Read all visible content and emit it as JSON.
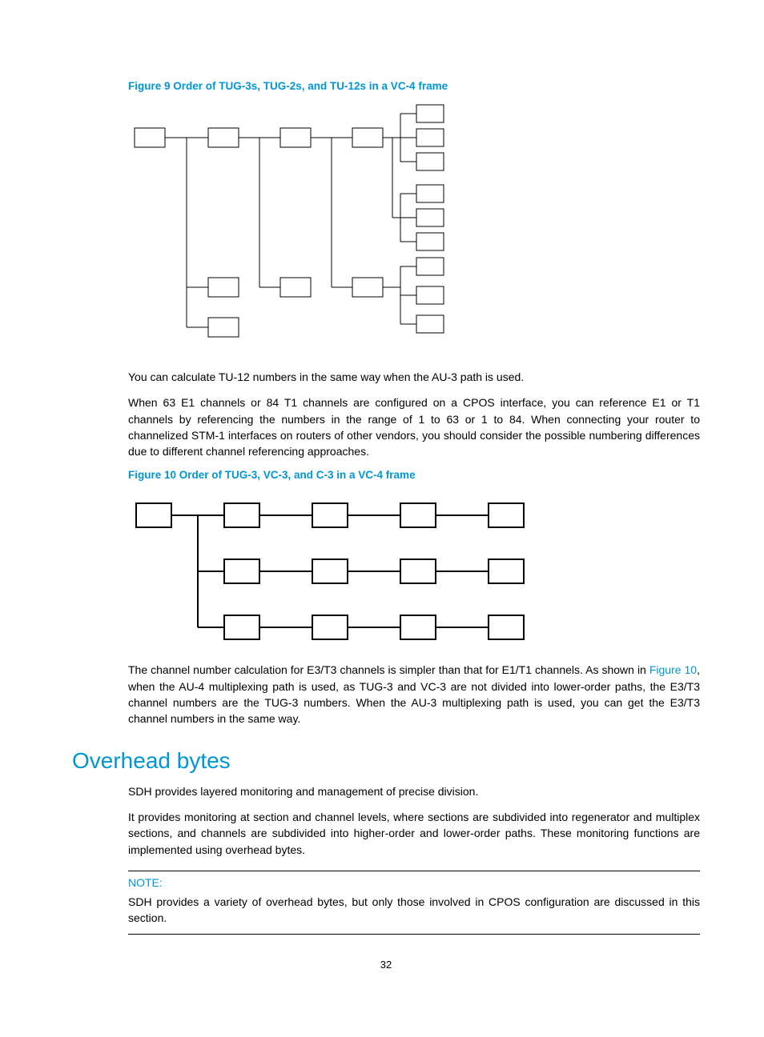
{
  "figure9": {
    "title": "Figure 9 Order of TUG-3s, TUG-2s, and TU-12s in a VC-4 frame"
  },
  "para1": "You can calculate TU-12 numbers in the same way when the AU-3 path is used.",
  "para2": "When 63 E1 channels or 84 T1 channels are configured on a CPOS interface, you can reference E1 or T1 channels by referencing the numbers in the range of 1 to 63 or 1 to 84. When connecting your router to channelized STM-1 interfaces on routers of other vendors, you should consider the possible numbering differences due to different channel referencing approaches.",
  "figure10": {
    "title": "Figure 10 Order of TUG-3, VC-3, and C-3 in a VC-4 frame",
    "ref": "Figure 10"
  },
  "para3_before": "The channel number calculation for E3/T3 channels is simpler than that for E1/T1 channels. As shown in ",
  "para3_after": ", when the AU-4 multiplexing path is used, as TUG-3 and VC-3 are not divided into lower-order paths, the E3/T3 channel numbers are the TUG-3 numbers. When the AU-3 multiplexing path is used, you can get the E3/T3 channel numbers in the same way.",
  "section_heading": "Overhead bytes",
  "para4": "SDH provides layered monitoring and management of precise division.",
  "para5": "It provides monitoring at section and channel levels, where sections are subdivided into regenerator and multiplex sections, and channels are subdivided into higher-order and lower-order paths. These monitoring functions are implemented using overhead bytes.",
  "note": {
    "label": "NOTE:",
    "content": "SDH provides a variety of overhead bytes, but only those involved in CPOS configuration are discussed in this section."
  },
  "page_number": "32"
}
